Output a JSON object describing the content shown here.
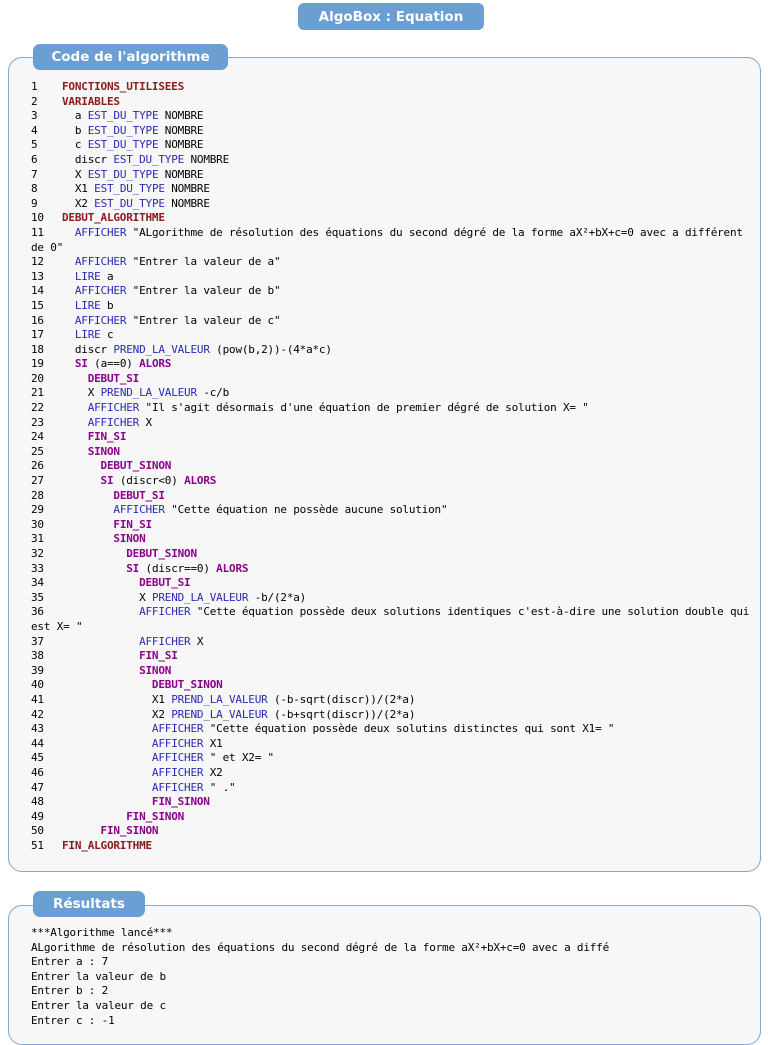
{
  "window": {
    "title": "AlgoBox : Equation"
  },
  "code_panel": {
    "title": "Code de l'algorithme",
    "lines": [
      {
        "n": "1",
        "indent": 1,
        "segs": [
          [
            "struct",
            "FONCTIONS_UTILISEES"
          ]
        ]
      },
      {
        "n": "2",
        "indent": 1,
        "segs": [
          [
            "struct",
            "VARIABLES"
          ]
        ]
      },
      {
        "n": "3",
        "indent": 2,
        "segs": [
          [
            "text",
            "a "
          ],
          [
            "op",
            "EST_DU_TYPE"
          ],
          [
            "text",
            " NOMBRE"
          ]
        ]
      },
      {
        "n": "4",
        "indent": 2,
        "segs": [
          [
            "text",
            "b "
          ],
          [
            "op",
            "EST_DU_TYPE"
          ],
          [
            "text",
            " NOMBRE"
          ]
        ]
      },
      {
        "n": "5",
        "indent": 2,
        "segs": [
          [
            "text",
            "c "
          ],
          [
            "op",
            "EST_DU_TYPE"
          ],
          [
            "text",
            " NOMBRE"
          ]
        ]
      },
      {
        "n": "6",
        "indent": 2,
        "segs": [
          [
            "text",
            "discr "
          ],
          [
            "op",
            "EST_DU_TYPE"
          ],
          [
            "text",
            " NOMBRE"
          ]
        ]
      },
      {
        "n": "7",
        "indent": 2,
        "segs": [
          [
            "text",
            "X "
          ],
          [
            "op",
            "EST_DU_TYPE"
          ],
          [
            "text",
            " NOMBRE"
          ]
        ]
      },
      {
        "n": "8",
        "indent": 2,
        "segs": [
          [
            "text",
            "X1 "
          ],
          [
            "op",
            "EST_DU_TYPE"
          ],
          [
            "text",
            " NOMBRE"
          ]
        ]
      },
      {
        "n": "9",
        "indent": 2,
        "segs": [
          [
            "text",
            "X2 "
          ],
          [
            "op",
            "EST_DU_TYPE"
          ],
          [
            "text",
            " NOMBRE"
          ]
        ]
      },
      {
        "n": "10",
        "indent": 1,
        "segs": [
          [
            "struct",
            "DEBUT_ALGORITHME"
          ]
        ]
      },
      {
        "n": "11",
        "indent": 2,
        "segs": [
          [
            "op",
            "AFFICHER"
          ],
          [
            "text",
            " \"ALgorithme de résolution des équations du second dégré de la forme aX²+bX+c=0 avec a différent de 0\""
          ]
        ]
      },
      {
        "n": "12",
        "indent": 2,
        "segs": [
          [
            "op",
            "AFFICHER"
          ],
          [
            "text",
            " \"Entrer la valeur de a\""
          ]
        ]
      },
      {
        "n": "13",
        "indent": 2,
        "segs": [
          [
            "op",
            "LIRE"
          ],
          [
            "text",
            " a"
          ]
        ]
      },
      {
        "n": "14",
        "indent": 2,
        "segs": [
          [
            "op",
            "AFFICHER"
          ],
          [
            "text",
            " \"Entrer la valeur de b\""
          ]
        ]
      },
      {
        "n": "15",
        "indent": 2,
        "segs": [
          [
            "op",
            "LIRE"
          ],
          [
            "text",
            " b"
          ]
        ]
      },
      {
        "n": "16",
        "indent": 2,
        "segs": [
          [
            "op",
            "AFFICHER"
          ],
          [
            "text",
            " \"Entrer la valeur de c\""
          ]
        ]
      },
      {
        "n": "17",
        "indent": 2,
        "segs": [
          [
            "op",
            "LIRE"
          ],
          [
            "text",
            " c"
          ]
        ]
      },
      {
        "n": "18",
        "indent": 2,
        "segs": [
          [
            "text",
            "discr "
          ],
          [
            "op",
            "PREND_LA_VALEUR"
          ],
          [
            "text",
            " (pow(b,2))-(4*a*c)"
          ]
        ]
      },
      {
        "n": "19",
        "indent": 2,
        "segs": [
          [
            "flow",
            "SI"
          ],
          [
            "text",
            " (a==0) "
          ],
          [
            "flow",
            "ALORS"
          ]
        ]
      },
      {
        "n": "20",
        "indent": 3,
        "segs": [
          [
            "flow",
            "DEBUT_SI"
          ]
        ]
      },
      {
        "n": "21",
        "indent": 3,
        "segs": [
          [
            "text",
            "X "
          ],
          [
            "op",
            "PREND_LA_VALEUR"
          ],
          [
            "text",
            " -c/b"
          ]
        ]
      },
      {
        "n": "22",
        "indent": 3,
        "segs": [
          [
            "op",
            "AFFICHER"
          ],
          [
            "text",
            " \"Il s'agit désormais d'une équation de premier dégré de solution X= \""
          ]
        ]
      },
      {
        "n": "23",
        "indent": 3,
        "segs": [
          [
            "op",
            "AFFICHER"
          ],
          [
            "text",
            " X"
          ]
        ]
      },
      {
        "n": "24",
        "indent": 3,
        "segs": [
          [
            "flow",
            "FIN_SI"
          ]
        ]
      },
      {
        "n": "25",
        "indent": 3,
        "segs": [
          [
            "flow",
            "SINON"
          ]
        ]
      },
      {
        "n": "26",
        "indent": 4,
        "segs": [
          [
            "flow",
            "DEBUT_SINON"
          ]
        ]
      },
      {
        "n": "27",
        "indent": 4,
        "segs": [
          [
            "flow",
            "SI"
          ],
          [
            "text",
            " (discr<0) "
          ],
          [
            "flow",
            "ALORS"
          ]
        ]
      },
      {
        "n": "28",
        "indent": 5,
        "segs": [
          [
            "flow",
            "DEBUT_SI"
          ]
        ]
      },
      {
        "n": "29",
        "indent": 5,
        "segs": [
          [
            "op",
            "AFFICHER"
          ],
          [
            "text",
            " \"Cette équation ne possède aucune solution\""
          ]
        ]
      },
      {
        "n": "30",
        "indent": 5,
        "segs": [
          [
            "flow",
            "FIN_SI"
          ]
        ]
      },
      {
        "n": "31",
        "indent": 5,
        "segs": [
          [
            "flow",
            "SINON"
          ]
        ]
      },
      {
        "n": "32",
        "indent": 6,
        "segs": [
          [
            "flow",
            "DEBUT_SINON"
          ]
        ]
      },
      {
        "n": "33",
        "indent": 6,
        "segs": [
          [
            "flow",
            "SI"
          ],
          [
            "text",
            " (discr==0) "
          ],
          [
            "flow",
            "ALORS"
          ]
        ]
      },
      {
        "n": "34",
        "indent": 7,
        "segs": [
          [
            "flow",
            "DEBUT_SI"
          ]
        ]
      },
      {
        "n": "35",
        "indent": 7,
        "segs": [
          [
            "text",
            "X "
          ],
          [
            "op",
            "PREND_LA_VALEUR"
          ],
          [
            "text",
            " -b/(2*a)"
          ]
        ]
      },
      {
        "n": "36",
        "indent": 7,
        "segs": [
          [
            "op",
            "AFFICHER"
          ],
          [
            "text",
            " \"Cette équation possède deux solutions identiques c'est-à-dire une solution double qui est X= \""
          ]
        ]
      },
      {
        "n": "37",
        "indent": 7,
        "segs": [
          [
            "op",
            "AFFICHER"
          ],
          [
            "text",
            " X"
          ]
        ]
      },
      {
        "n": "38",
        "indent": 7,
        "segs": [
          [
            "flow",
            "FIN_SI"
          ]
        ]
      },
      {
        "n": "39",
        "indent": 7,
        "segs": [
          [
            "flow",
            "SINON"
          ]
        ]
      },
      {
        "n": "40",
        "indent": 8,
        "segs": [
          [
            "flow",
            "DEBUT_SINON"
          ]
        ]
      },
      {
        "n": "41",
        "indent": 8,
        "segs": [
          [
            "text",
            "X1 "
          ],
          [
            "op",
            "PREND_LA_VALEUR"
          ],
          [
            "text",
            " (-b-sqrt(discr))/(2*a)"
          ]
        ]
      },
      {
        "n": "42",
        "indent": 8,
        "segs": [
          [
            "text",
            "X2 "
          ],
          [
            "op",
            "PREND_LA_VALEUR"
          ],
          [
            "text",
            " (-b+sqrt(discr))/(2*a)"
          ]
        ]
      },
      {
        "n": "43",
        "indent": 8,
        "segs": [
          [
            "op",
            "AFFICHER"
          ],
          [
            "text",
            " \"Cette équation possède deux solutins distinctes qui sont X1= \""
          ]
        ]
      },
      {
        "n": "44",
        "indent": 8,
        "segs": [
          [
            "op",
            "AFFICHER"
          ],
          [
            "text",
            " X1"
          ]
        ]
      },
      {
        "n": "45",
        "indent": 8,
        "segs": [
          [
            "op",
            "AFFICHER"
          ],
          [
            "text",
            " \" et X2= \""
          ]
        ]
      },
      {
        "n": "46",
        "indent": 8,
        "segs": [
          [
            "op",
            "AFFICHER"
          ],
          [
            "text",
            " X2"
          ]
        ]
      },
      {
        "n": "47",
        "indent": 8,
        "segs": [
          [
            "op",
            "AFFICHER"
          ],
          [
            "text",
            " \" .\""
          ]
        ]
      },
      {
        "n": "48",
        "indent": 8,
        "segs": [
          [
            "flow",
            "FIN_SINON"
          ]
        ]
      },
      {
        "n": "49",
        "indent": 6,
        "segs": [
          [
            "flow",
            "FIN_SINON"
          ]
        ]
      },
      {
        "n": "50",
        "indent": 4,
        "segs": [
          [
            "flow",
            "FIN_SINON"
          ]
        ]
      },
      {
        "n": "51",
        "indent": 1,
        "segs": [
          [
            "struct",
            "FIN_ALGORITHME"
          ]
        ]
      }
    ]
  },
  "results_panel": {
    "title": "Résultats",
    "lines": [
      "***Algorithme lancé***",
      "ALgorithme de résolution des équations du second dégré de la forme aX²+bX+c=0 avec a diffé",
      "Entrer a : 7",
      "Entrer la valeur de b",
      "Entrer b : 2",
      "Entrer la valeur de c",
      "Entrer c : -1"
    ]
  },
  "colors": {
    "accent": "#6b9fd3",
    "struct_keyword": "#8b1a1a",
    "operation_keyword": "#2a2ab2",
    "flow_keyword": "#8b008b"
  }
}
